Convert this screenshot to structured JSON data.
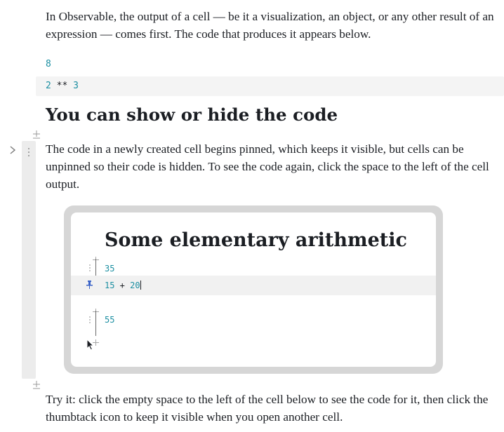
{
  "intro": {
    "paragraph": "In Observable, the output of a cell — be it a visualization, an object, or any other result of an expression — comes first. The code that produces it appears below."
  },
  "example_cell": {
    "output": "8",
    "code_base": "2",
    "code_op": " ** ",
    "code_exp": "3"
  },
  "section": {
    "heading": "You can show or hide the code",
    "paragraph": "The code in a newly created cell begins pinned, which keeps it visible, but cells can be unpinned so their code is hidden. To see the code again, click the space to the left of the cell output."
  },
  "screenshot": {
    "title": "Some elementary arithmetic",
    "output_1": "35",
    "code_a": "15",
    "code_op": " + ",
    "code_b": "20",
    "output_2": "55"
  },
  "try_it": {
    "paragraph": "Try it: click the empty space to the left of the cell below to see the code for it, then click the thumbtack icon to keep it visible when you open another cell."
  },
  "icons": {
    "gutter": "drag-handle-icon",
    "chevron": "chevron-right-icon",
    "add": "add-cell-icon",
    "pin": "pin-icon",
    "cursor": "mouse-cursor-icon"
  },
  "colors": {
    "number": "#1a8ea1",
    "code_bg": "#f4f4f4",
    "gutter_bg": "#ececec"
  }
}
